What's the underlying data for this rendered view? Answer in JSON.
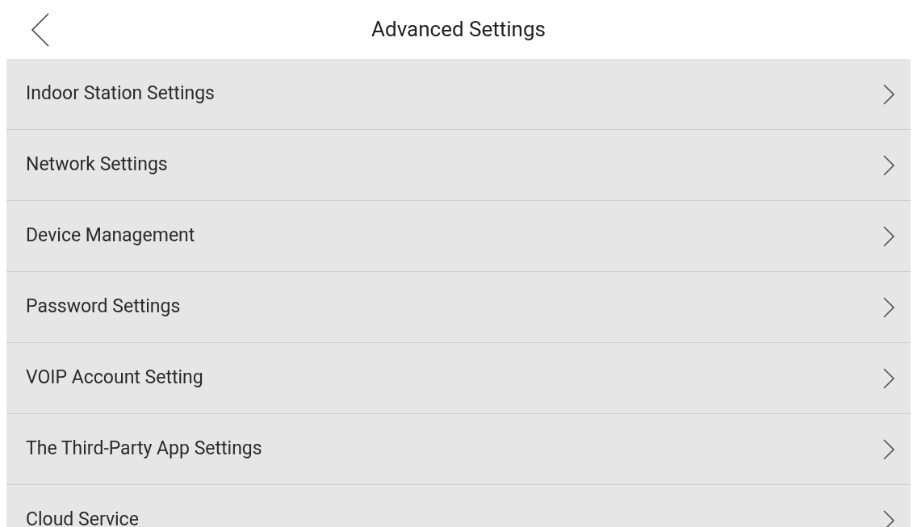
{
  "header": {
    "title": "Advanced Settings"
  },
  "items": [
    {
      "label": "Indoor Station Settings"
    },
    {
      "label": "Network Settings"
    },
    {
      "label": "Device Management"
    },
    {
      "label": "Password Settings"
    },
    {
      "label": "VOIP Account Setting"
    },
    {
      "label": "The Third-Party App Settings"
    },
    {
      "label": "Cloud Service"
    }
  ]
}
